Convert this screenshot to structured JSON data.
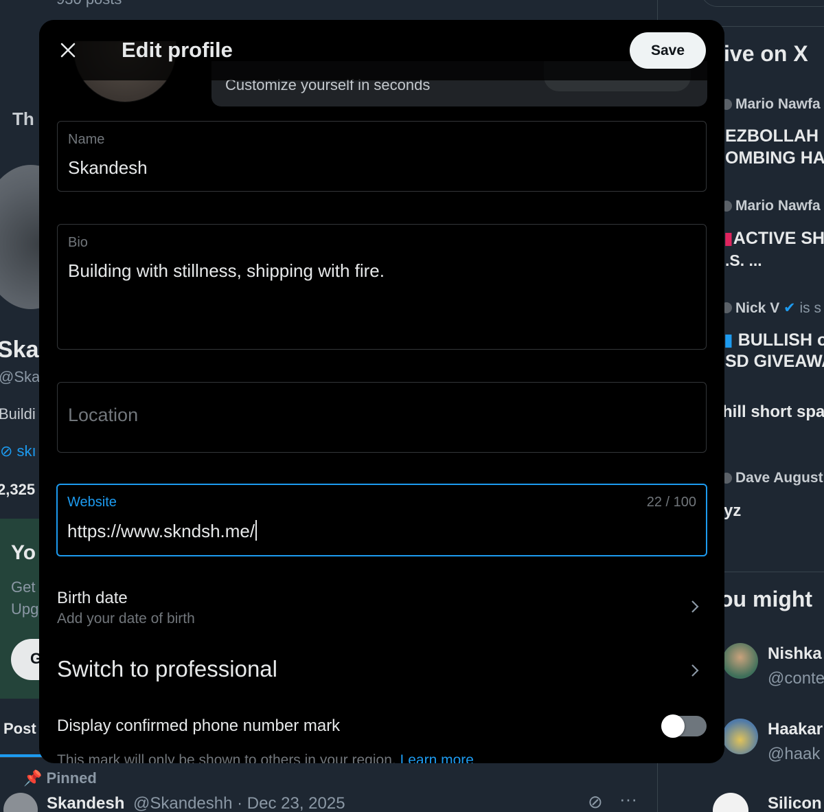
{
  "background": {
    "posts_count": "930 posts",
    "left_header_partial": "Th",
    "left_name_partial": "Skar",
    "left_handle_partial": "@Ska",
    "left_bio_partial": "Buildi",
    "left_link_partial": "skı",
    "left_count_partial": "2,325",
    "premium_title_partial": "Yo",
    "premium_sub1_partial": "Get",
    "premium_sub2_partial": "Upg",
    "premium_btn_partial": "G",
    "posts_tab_partial": "Post",
    "pinned_label": "Pinned",
    "pinned_name": "Skandesh",
    "pinned_meta": "@Skandeshh · Dec 23, 2025",
    "live_title_partial": "ive on X",
    "live_items": [
      {
        "author": "Mario Nawfa",
        "line1": "EZBOLLAH &",
        "line2": "OMBING HA"
      },
      {
        "author": "Mario Nawfa",
        "line1": "ACTIVE SH",
        "line2": ".S. ..."
      },
      {
        "author": "Nick V",
        "suffix": "is s",
        "line1": "BULLISH o",
        "line2": "SD GIVEAWA"
      },
      {
        "author": "",
        "line1": "hill short spa",
        "line2": ""
      },
      {
        "author": "Dave August",
        "line1": "yz",
        "line2": ""
      }
    ],
    "might_like_partial": "ou might",
    "suggestions": [
      {
        "name": "Nishka",
        "handle": "@conte"
      },
      {
        "name": "Haakar",
        "handle": "@haak"
      },
      {
        "name": "Silicon",
        "handle": ""
      }
    ]
  },
  "modal": {
    "title": "Edit profile",
    "save_label": "Save",
    "customize_text": "Customize yourself in seconds",
    "name_field": {
      "label": "Name",
      "value": "Skandesh"
    },
    "bio_field": {
      "label": "Bio",
      "value": "Building with stillness, shipping with fire."
    },
    "location_field": {
      "placeholder": "Location"
    },
    "website_field": {
      "label": "Website",
      "value": "https://www.skndsh.me/",
      "counter": "22 / 100"
    },
    "birth_date": {
      "title": "Birth date",
      "subtitle": "Add your date of birth"
    },
    "switch_professional": "Switch to professional",
    "phone_mark": {
      "label": "Display confirmed phone number mark",
      "enabled": false
    },
    "footnote": {
      "text": "This mark will only be shown to others in your region. ",
      "link": "Learn more"
    }
  },
  "colors": {
    "accent": "#1d9bf0",
    "modal_bg": "#000000",
    "page_bg": "#1e2732"
  }
}
